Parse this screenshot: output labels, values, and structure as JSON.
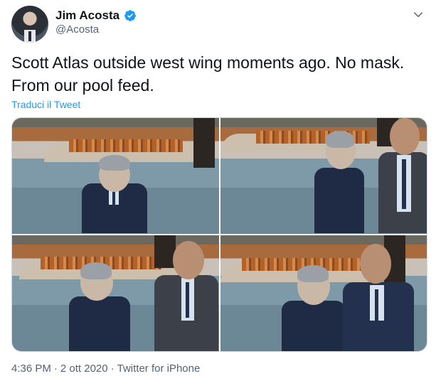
{
  "author": {
    "name": "Jim Acosta",
    "handle": "@Acosta"
  },
  "tweet": {
    "text": "Scott Atlas outside west wing moments ago. No mask. From our pool feed.",
    "translate_label": "Traduci il Tweet"
  },
  "media": {
    "photo_count": 4
  },
  "meta": {
    "time": "4:36 PM",
    "separator": "·",
    "date": "2 ott 2020",
    "source": "Twitter for iPhone"
  },
  "icons": {
    "verified": "verified-badge-icon",
    "more": "chevron-down-icon"
  },
  "colors": {
    "link": "#1d9bf0",
    "secondary_text": "#536471",
    "primary_text": "#0f1419"
  }
}
